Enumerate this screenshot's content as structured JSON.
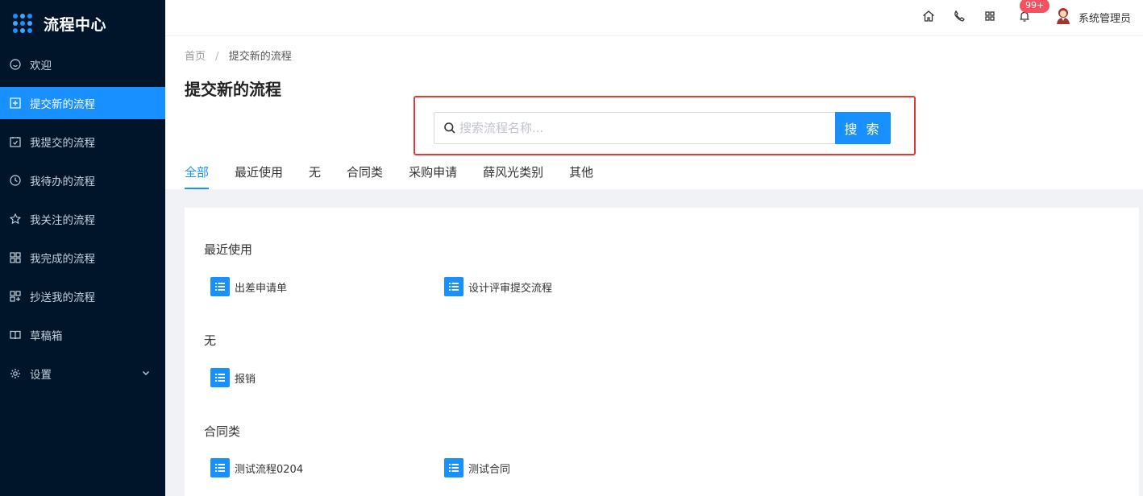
{
  "brand": {
    "title": "流程中心"
  },
  "sidebar": {
    "items": [
      {
        "label": "欢迎",
        "icon": "smile-icon"
      },
      {
        "label": "提交新的流程",
        "icon": "plus-square-icon",
        "active": true
      },
      {
        "label": "我提交的流程",
        "icon": "calendar-check-icon"
      },
      {
        "label": "我待办的流程",
        "icon": "clock-icon"
      },
      {
        "label": "我关注的流程",
        "icon": "star-icon"
      },
      {
        "label": "我完成的流程",
        "icon": "grid-icon"
      },
      {
        "label": "抄送我的流程",
        "icon": "share-grid-icon"
      },
      {
        "label": "草稿箱",
        "icon": "book-icon"
      },
      {
        "label": "设置",
        "icon": "gear-icon",
        "has_submenu": true
      }
    ]
  },
  "header": {
    "icons": [
      "home-icon",
      "phone-icon",
      "apps-icon",
      "bell-icon"
    ],
    "badge": "99+",
    "username": "系统管理员"
  },
  "breadcrumb": {
    "home": "首页",
    "separator": "/",
    "current": "提交新的流程"
  },
  "page": {
    "title": "提交新的流程"
  },
  "search": {
    "placeholder": "搜索流程名称...",
    "value": "",
    "button_label": "搜 索"
  },
  "tabs": [
    {
      "label": "全部",
      "active": true
    },
    {
      "label": "最近使用"
    },
    {
      "label": "无"
    },
    {
      "label": "合同类"
    },
    {
      "label": "采购申请"
    },
    {
      "label": "薛风光类别"
    },
    {
      "label": "其他"
    }
  ],
  "groups": [
    {
      "title": "最近使用",
      "items": [
        "出差申请单",
        "设计评审提交流程"
      ]
    },
    {
      "title": "无",
      "items": [
        "报销"
      ]
    },
    {
      "title": "合同类",
      "items": [
        "测试流程0204",
        "测试合同"
      ]
    }
  ],
  "colors": {
    "sidebar_bg": "#001529",
    "accent": "#1890ff",
    "highlight_border": "#e53935",
    "badge": "#f5515f"
  }
}
